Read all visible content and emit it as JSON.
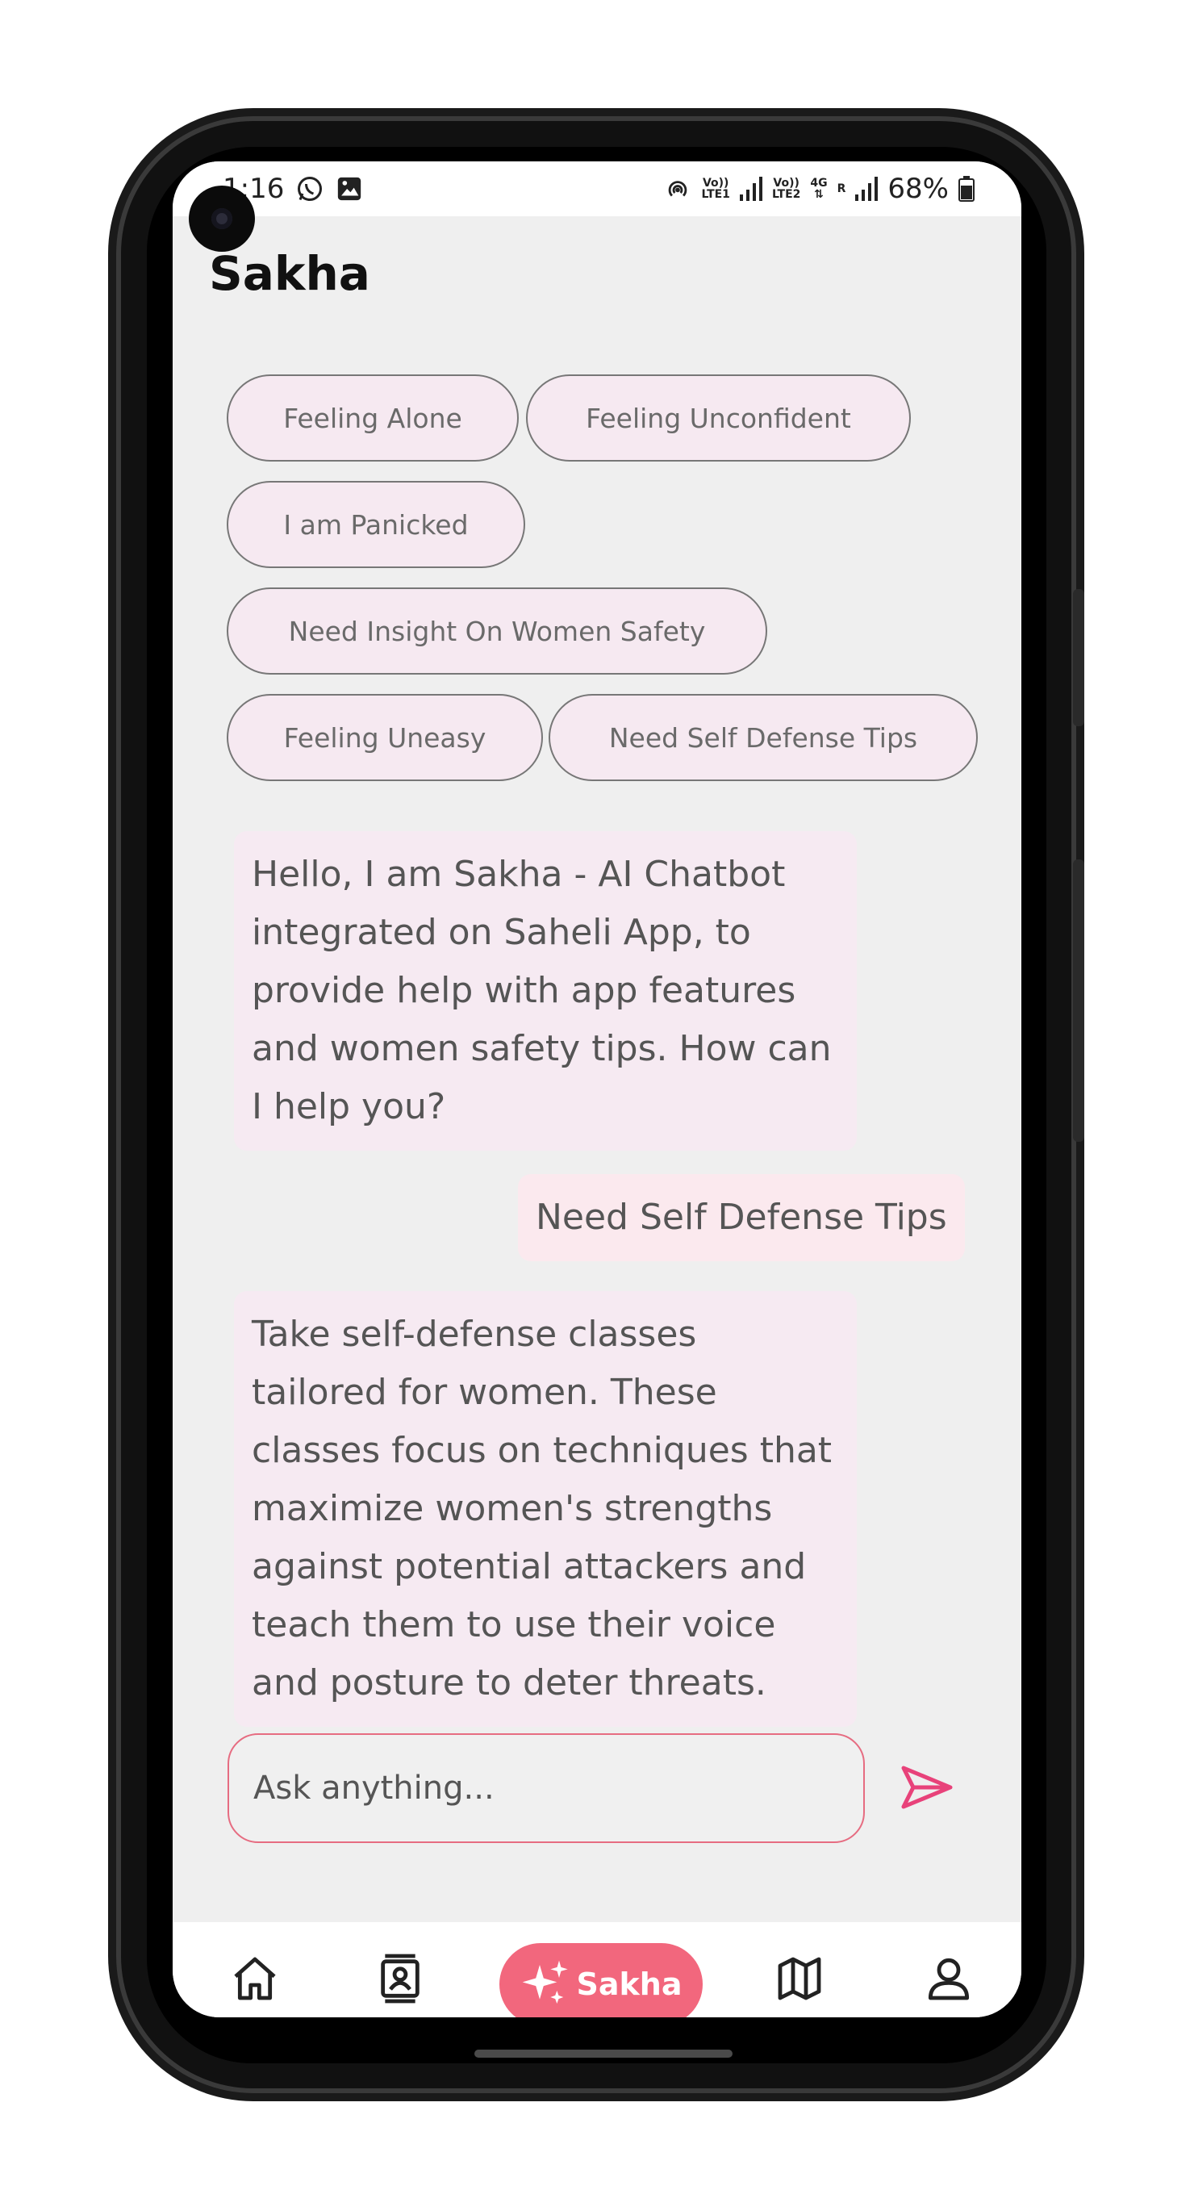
{
  "status_bar": {
    "time": "1:16",
    "battery": "68%",
    "sim1_top": "Vo))",
    "sim1_bottom": "LTE1",
    "sim2_top": "Vo))",
    "sim2_bottom": "LTE2",
    "network_type": "4G",
    "roaming": "R",
    "icons": [
      "whatsapp-icon",
      "gallery-icon",
      "hotspot-icon",
      "signal-icon",
      "battery-icon"
    ]
  },
  "header": {
    "title": "Sakha"
  },
  "suggestions": [
    "Feeling Alone",
    "Feeling Unconfident",
    "I am Panicked",
    "Need Insight On Women Safety",
    "Feeling Uneasy",
    "Need Self Defense Tips"
  ],
  "messages": [
    {
      "sender": "bot",
      "text": "Hello, I am Sakha - AI Chatbot integrated on Saheli App, to provide help with app features and women safety tips. How can I help you?"
    },
    {
      "sender": "user",
      "text": "Need Self Defense Tips"
    },
    {
      "sender": "bot",
      "text": "Take self-defense classes tailored for women. These classes focus on techniques that maximize women's strengths against potential attackers and teach them to use their voice and posture to deter threats."
    }
  ],
  "input": {
    "placeholder": "Ask anything..."
  },
  "nav": {
    "items": [
      "home-icon",
      "contacts-icon",
      "sparkle-icon",
      "map-icon",
      "profile-icon"
    ],
    "active_label": "Sakha"
  },
  "colors": {
    "accent": "#f2677d",
    "send": "#e8427a",
    "chip_bg": "#f6e9f1",
    "bubble_bg": "#f6eaf2",
    "screen_bg": "#efefef"
  }
}
